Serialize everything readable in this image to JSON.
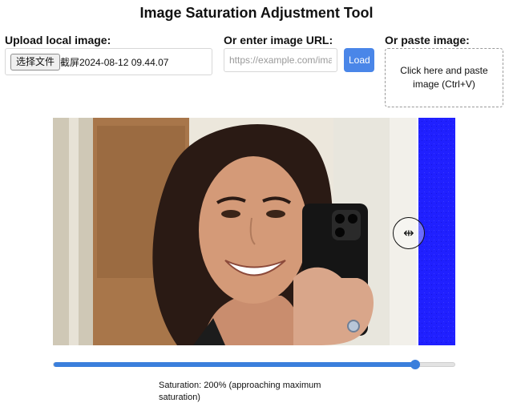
{
  "page": {
    "title": "Image Saturation Adjustment Tool"
  },
  "upload": {
    "label": "Upload local image:",
    "button_label": "选择文件",
    "file_name": "截屏2024-08-12 09.44.07"
  },
  "url": {
    "label": "Or enter image URL:",
    "placeholder": "https://example.com/image.jpg",
    "value": "",
    "load_label": "Load"
  },
  "paste": {
    "label": "Or paste image:",
    "hint": "Click here and paste image (Ctrl+V)"
  },
  "compare": {
    "divider_icon": "resize-horizontal-icon",
    "divider_position": 0.89
  },
  "saturation": {
    "value_fraction": 0.9,
    "label": "Saturation: 200% (approaching maximum saturation)"
  },
  "colors": {
    "accent": "#3b7fdc",
    "load_button": "#4a86e8",
    "saturated_overlay": "#2020ff"
  }
}
